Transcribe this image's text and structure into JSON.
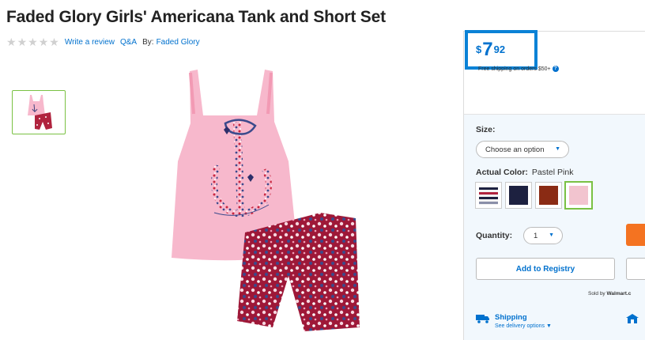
{
  "product": {
    "title": "Faded Glory Girls' Americana Tank and Short Set",
    "write_review": "Write a review",
    "qa": "Q&A",
    "by_label": "By:",
    "brand": "Faded Glory",
    "rating_stars": 0,
    "rating_max": 5
  },
  "price": {
    "currency": "$",
    "whole": "7",
    "cents": "92"
  },
  "shipping_note": "Free shipping on orders $50+",
  "size": {
    "label": "Size:",
    "selected": "Choose an option"
  },
  "color": {
    "label": "Actual Color:",
    "value": "Pastel Pink",
    "swatches": [
      {
        "name": "Americana print",
        "hex": "#8a8fa8"
      },
      {
        "name": "Navy",
        "hex": "#1d2140"
      },
      {
        "name": "Rust",
        "hex": "#8a2b14"
      },
      {
        "name": "Pastel Pink",
        "hex": "#f2c4cf"
      }
    ],
    "selected_index": 3
  },
  "quantity": {
    "label": "Quantity:",
    "value": "1"
  },
  "buttons": {
    "registry": "Add to Registry"
  },
  "seller": {
    "prefix": "Sold by",
    "name": "Walmart.c"
  },
  "delivery": {
    "title": "Shipping",
    "subtitle": "See delivery options"
  },
  "colors": {
    "accent": "#0071ce",
    "price_border": "#0a82d6",
    "selected_green": "#7ac143",
    "cart_orange": "#f47321"
  }
}
